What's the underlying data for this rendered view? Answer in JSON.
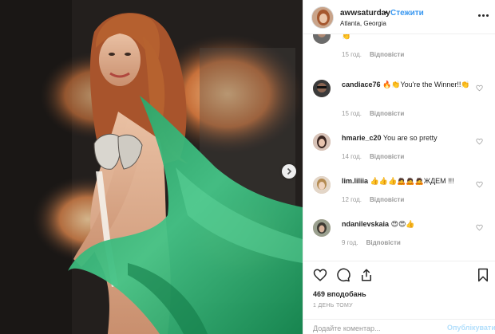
{
  "header": {
    "username": "awwsaturday",
    "separator": "•",
    "follow_label": "Стежити",
    "location": "Atlanta, Georgia"
  },
  "comments": [
    {
      "username": "",
      "text": "👏",
      "time": "15 год.",
      "reply": "Відповісти"
    },
    {
      "username": "candiace76",
      "text": "🔥👏You're the Winner!!👏",
      "time": "15 год.",
      "reply": "Відповісти"
    },
    {
      "username": "hmarie_c20",
      "text": "You are so pretty",
      "time": "14 год.",
      "reply": "Відповісти"
    },
    {
      "username": "lim.liliia",
      "text": "👍👍👍🙇🙇🙇ЖДЕМ !!!",
      "time": "12 год.",
      "reply": "Відповісти"
    },
    {
      "username": "ndanilevskaia",
      "text": "😍😍👍",
      "time": "9 год.",
      "reply": "Відповісти"
    }
  ],
  "likes": "469 вподобань",
  "timestamp": "1 ДЕНЬ ТОМУ",
  "add_comment": {
    "placeholder": "Додайте коментар...",
    "post_label": "Опублікувати"
  },
  "icons": {
    "heart": "heart-icon",
    "comment": "comment-icon",
    "share": "share-icon",
    "bookmark": "bookmark-icon",
    "more": "more-options-icon",
    "next": "chevron-right-icon"
  },
  "colors": {
    "accent": "#3897f0",
    "post_disabled": "#b2dffc",
    "muted": "#999999",
    "dress": "#2fa36b"
  }
}
